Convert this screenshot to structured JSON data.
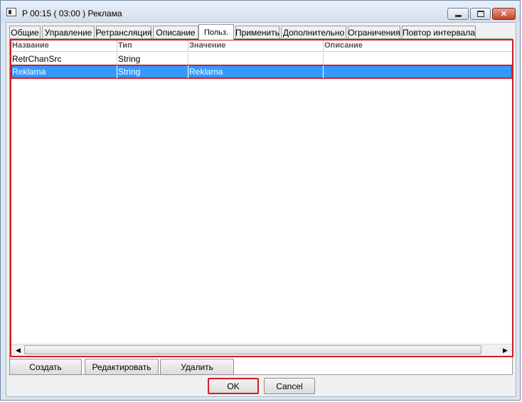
{
  "window": {
    "title": "P 00:15 ( 03:00 ) Реклама"
  },
  "tabs": [
    {
      "label": "Общие"
    },
    {
      "label": "Управление"
    },
    {
      "label": "Ретрансляция"
    },
    {
      "label": "Описание"
    },
    {
      "label": "Польз."
    },
    {
      "label": "Применить"
    },
    {
      "label": "Дополнительно"
    },
    {
      "label": "Ограничения"
    },
    {
      "label": "Повтор интервала"
    }
  ],
  "active_tab": "Польз.",
  "table": {
    "columns": [
      "Название",
      "Тип",
      "Значение",
      "Описание"
    ],
    "rows": [
      [
        "RetrChanSrc",
        "String",
        "",
        ""
      ],
      [
        "Reklama",
        "String",
        "Reklama",
        ""
      ]
    ],
    "selected_row": 2
  },
  "buttons": {
    "create": "Создать",
    "edit": "Редактировать",
    "delete": "Удалить",
    "ok": "OK",
    "cancel": "Cancel"
  },
  "colors": {
    "selection": "#3399ff",
    "highlight_border": "#d11c2a",
    "close_button": "#c5422b"
  },
  "icons": {
    "minimize": "minimize-icon",
    "maximize": "maximize-icon",
    "close": "close-icon",
    "scroll_left": "arrow-left-icon",
    "scroll_right": "arrow-right-icon",
    "app": "app-window-icon"
  }
}
